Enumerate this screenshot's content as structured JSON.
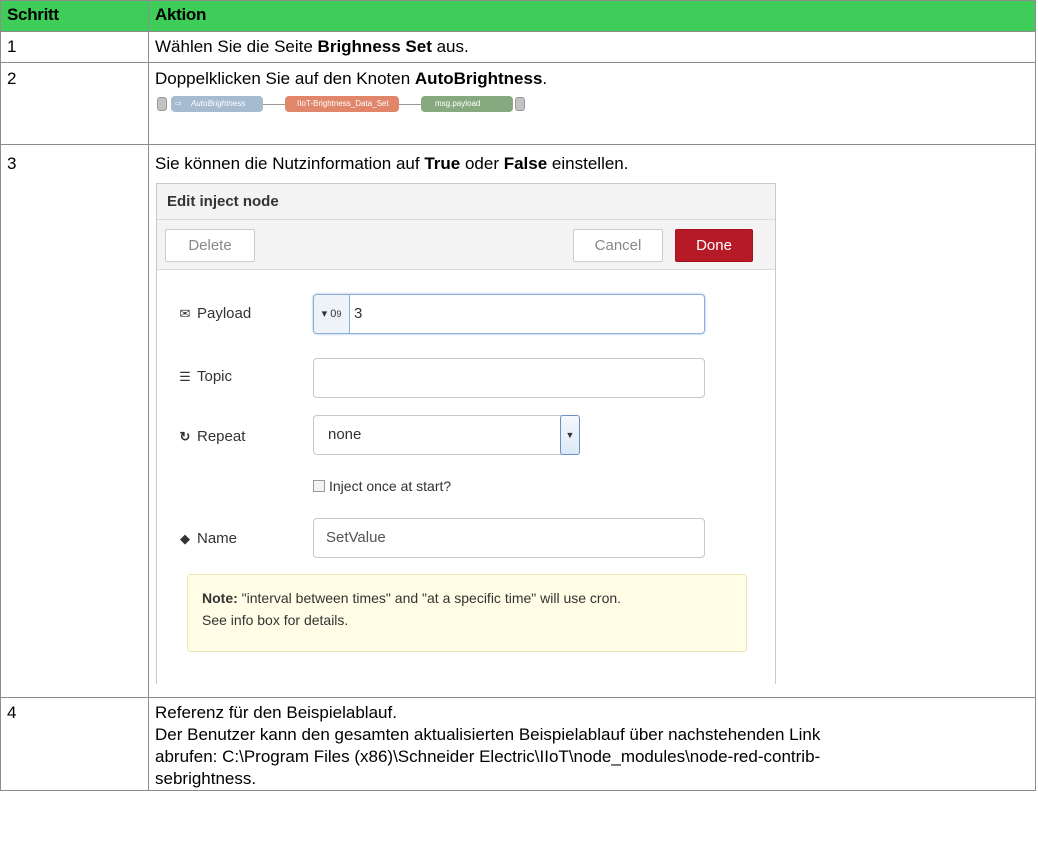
{
  "table": {
    "headers": [
      "Schritt",
      "Aktion"
    ],
    "rows": [
      {
        "step": "1",
        "pre": "Wählen Sie die Seite ",
        "bold": "Brighness Set",
        "post": " aus."
      },
      {
        "step": "2",
        "pre": "Doppelklicken Sie auf den Knoten ",
        "bold": "AutoBrightness",
        "post": "."
      },
      {
        "step": "3",
        "pre": "Sie können die Nutzinformation auf ",
        "bold1": "True",
        "mid": " oder ",
        "bold2": "False",
        "post": " einstellen."
      },
      {
        "step": "4",
        "line1": "Referenz für den Beispielablauf.",
        "line2": "Der Benutzer kann den gesamten aktualisierten Beispielablauf über nachstehenden Link",
        "line3": "abrufen: C:\\Program Files (x86)\\Schneider Electric\\IIoT\\node_modules\\node-red-contrib-",
        "line4": "sebrightness."
      }
    ]
  },
  "flow": {
    "node1": "AutoBrightness",
    "node2": "IIoT-Brightness_Data_Set",
    "node3": "msg.payload",
    "colors": {
      "inject": "#a6bbcf",
      "function": "#e2866b",
      "debug": "#87a980"
    }
  },
  "dialog": {
    "title": "Edit inject node",
    "delete_label": "Delete",
    "cancel_label": "Cancel",
    "done_label": "Done",
    "payload_label": "Payload",
    "payload_type_top": "0",
    "payload_type_sub": "9",
    "payload_value": "3",
    "topic_label": "Topic",
    "topic_value": "",
    "repeat_label": "Repeat",
    "repeat_value": "none",
    "inject_once_label": "Inject once at start?",
    "inject_once_checked": false,
    "name_label": "Name",
    "name_value": "SetValue",
    "note_bold": "Note:",
    "note_text": " \"interval between times\" and \"at a specific time\" will use cron.",
    "note_text2": "See info box for details."
  },
  "colors": {
    "header_bg": "#3dcd58",
    "done_bg": "#b61a27"
  }
}
